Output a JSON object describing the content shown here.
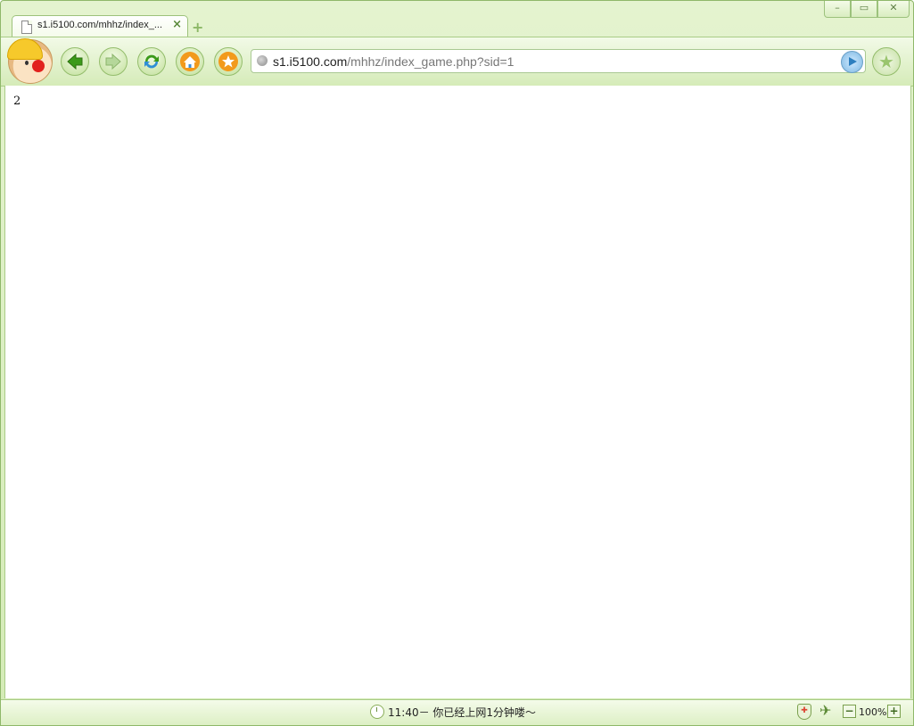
{
  "tab": {
    "title": "s1.i5100.com/mhhz/index_...",
    "close_glyph": "×",
    "new_glyph": "+"
  },
  "window_controls": {
    "minimize": "–",
    "maximize": "▭",
    "close": "✕"
  },
  "address": {
    "host": "s1.i5100.com",
    "path": "/mhhz/index_game.php?sid=1"
  },
  "content": {
    "text": "2"
  },
  "status": {
    "message": "11:40－ 你已经上网1分钟喽～",
    "zoom": "100%",
    "zoom_out": "−",
    "zoom_in": "+"
  },
  "icons": [
    "page-icon",
    "back-icon",
    "forward-icon",
    "refresh-icon",
    "home-icon",
    "favorite-icon",
    "globe-icon",
    "go-icon",
    "star-icon",
    "clock-icon",
    "shield-icon",
    "plane-icon"
  ],
  "colors": {
    "frame": "#8fb86a",
    "toolbar": "#d5ebb8"
  }
}
